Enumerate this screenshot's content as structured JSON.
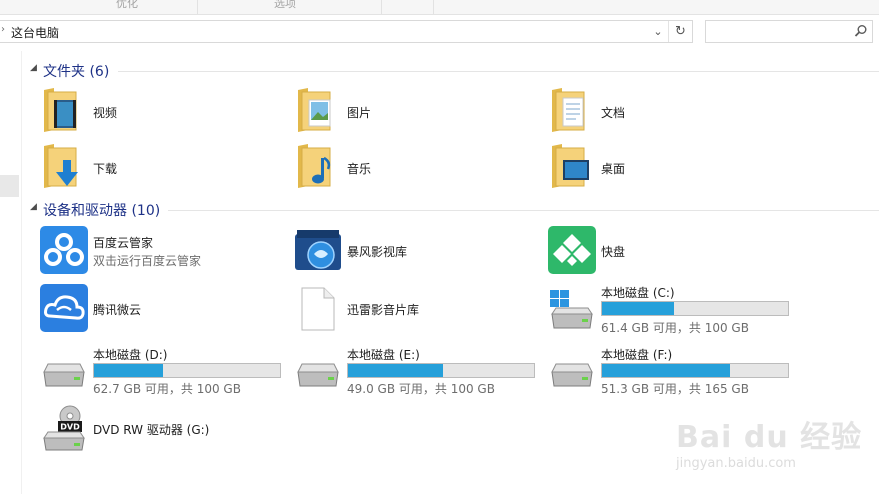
{
  "ribbon": {
    "groups": [
      {
        "label": "优化"
      },
      {
        "label": "选项"
      }
    ]
  },
  "address": {
    "path": "这台电脑",
    "chevron": "›",
    "dropdown_glyph": "⌄",
    "refresh_glyph": "↻"
  },
  "search": {
    "placeholder": ""
  },
  "folders_group": {
    "title": "文件夹 (6)",
    "items": [
      {
        "label": "视频",
        "icon": "videos-folder-icon"
      },
      {
        "label": "图片",
        "icon": "pictures-folder-icon"
      },
      {
        "label": "文档",
        "icon": "documents-folder-icon"
      },
      {
        "label": "下载",
        "icon": "downloads-folder-icon"
      },
      {
        "label": "音乐",
        "icon": "music-folder-icon"
      },
      {
        "label": "桌面",
        "icon": "desktop-folder-icon"
      }
    ]
  },
  "devices_group": {
    "title": "设备和驱动器 (10)",
    "apps": [
      {
        "label": "百度云管家",
        "sub": "双击运行百度云管家",
        "icon": "baidu-cloud-icon"
      },
      {
        "label": "暴风影视库",
        "icon": "baofeng-library-icon"
      },
      {
        "label": "快盘",
        "icon": "kuaipan-icon"
      },
      {
        "label": "腾讯微云",
        "icon": "tencent-weiyun-icon"
      },
      {
        "label": "迅雷影音片库",
        "icon": "blank-file-icon"
      }
    ],
    "drives": [
      {
        "label": "本地磁盘 (C:)",
        "free": "61.4 GB 可用，共 100 GB",
        "used_fraction": 0.386,
        "icon": "system-drive-icon"
      },
      {
        "label": "本地磁盘 (D:)",
        "free": "62.7 GB 可用，共 100 GB",
        "used_fraction": 0.373,
        "icon": "hard-drive-icon"
      },
      {
        "label": "本地磁盘 (E:)",
        "free": "49.0 GB 可用，共 100 GB",
        "used_fraction": 0.51,
        "icon": "hard-drive-icon"
      },
      {
        "label": "本地磁盘 (F:)",
        "free": "51.3 GB 可用，共 165 GB",
        "used_fraction": 0.689,
        "icon": "hard-drive-icon"
      }
    ],
    "dvd": {
      "label": "DVD RW 驱动器 (G:)",
      "icon": "dvd-drive-icon"
    }
  },
  "watermark": {
    "main": "Bai du 经验",
    "sub": "jingyan.baidu.com"
  },
  "colors": {
    "accent": "#26a0da",
    "group_title": "#1e3287",
    "bar_bg": "#e6e6e6"
  }
}
